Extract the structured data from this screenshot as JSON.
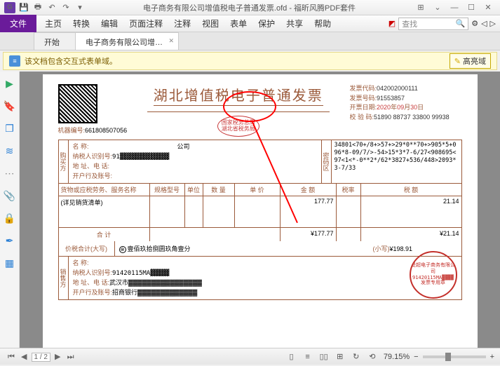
{
  "titlebar": {
    "filename": "电子商务有限公司增值税电子普通发票.ofd - 福昕风腾PDF套件"
  },
  "menu": {
    "file": "文件",
    "items": [
      "主页",
      "转换",
      "编辑",
      "页面注释",
      "注释",
      "视图",
      "表单",
      "保护",
      "共享",
      "帮助"
    ],
    "search_placeholder": "查找"
  },
  "tabs": [
    {
      "label": "开始"
    },
    {
      "label": "电子商务有限公司增…"
    }
  ],
  "infobar": {
    "msg": "该文档包含交互式表单域。",
    "highlight": "高亮域"
  },
  "fapiao": {
    "title": "湖北增值税电子普通发票",
    "seal_top": "国家税务总局",
    "seal_bot": "湖北省税务局",
    "codes": {
      "l1": "发票代码:",
      "v1": "042002000111",
      "l2": "发票号码:",
      "v2": "91553857",
      "l3": "开票日期:",
      "v3_y": "2020",
      "v3_m": "09",
      "v3_d": "30",
      "y": "年",
      "m": "月",
      "d": "日",
      "l4": "校 验 码:",
      "v4": "51890 88737 33800 99938"
    },
    "machine_l": "机器编号:",
    "machine_v": "661808507056",
    "buyer_label": "购买方",
    "buyer": {
      "l1": "名    称:",
      "v1": "　　　　　　　　　　　　　　公司",
      "l2": "纳税人识别号:",
      "v2": "91▓▓▓▓▓▓▓▓▓▓▓▓▓",
      "l3": "地 址、电 话:",
      "l4": "开户行及账号:"
    },
    "cipher_label": "密码区",
    "cipher": "34801<70+/8+>57+>29*0**70+>905*5+096*8-09/7/>-54>15*3*7-6/27<908695<97<1<*-0**2*/62*3827+536/448>2093*3-7/33",
    "cols": {
      "name": "货物或应税劳务、服务名称",
      "spec": "规格型号",
      "unit": "单位",
      "qty": "数  量",
      "price": "单  价",
      "amt": "金  额",
      "rate": "税率",
      "tax": "税  额"
    },
    "item": {
      "name": "(详见销货清单)",
      "amt": "177.77",
      "tax": "21.14"
    },
    "total_lbl": "合    计",
    "total_amt": "¥177.77",
    "total_tax": "¥21.14",
    "cap_lbl": "价税合计(大写)",
    "cap_val": "壹佰玖拾捌圆玖角壹分",
    "small_lbl": "(小写)",
    "small_val": "¥198.91",
    "seller_label": "销售方",
    "seller": {
      "l1": "名    称:",
      "v1": "　　　　　　　　　　",
      "l2": "纳税人识别号:",
      "v2": "91420115MA▓▓▓▓▓",
      "l3": "地 址、电 话:",
      "v3": "武汉市▓▓▓▓▓▓▓▓▓▓▓▓▓▓▓▓",
      "l4": "开户行及账号:",
      "v4": "招商银行▓▓▓▓▓▓▓▓▓▓▓▓▓"
    },
    "round_seal": {
      "t1": "旻超电子商务有限公司",
      "t2": "91420115MA▓▓▓▓",
      "t3": "发票专用章"
    }
  },
  "status": {
    "page": "1 / 2",
    "zoom": "79.15%"
  }
}
